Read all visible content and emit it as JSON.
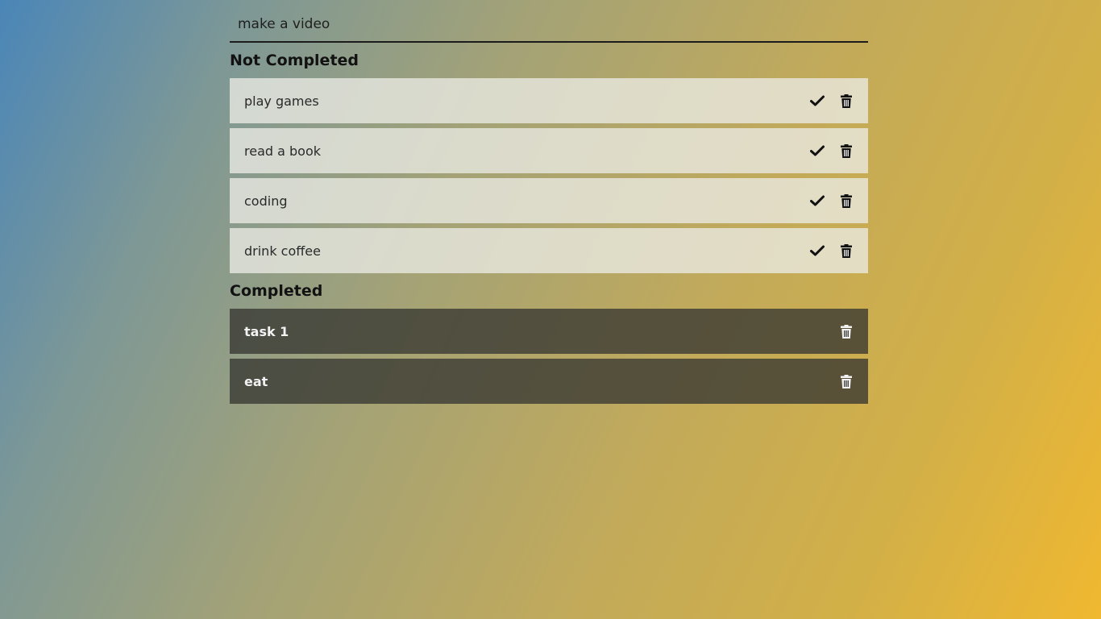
{
  "input": {
    "value": "make a video",
    "placeholder": ""
  },
  "sections": {
    "not_completed_title": "Not Completed",
    "completed_title": "Completed"
  },
  "not_completed": [
    {
      "label": "play games"
    },
    {
      "label": "read a book"
    },
    {
      "label": "coding"
    },
    {
      "label": "drink coffee"
    }
  ],
  "completed": [
    {
      "label": "task 1"
    },
    {
      "label": "eat"
    }
  ],
  "icons": {
    "complete": "check-icon",
    "delete": "trash-icon"
  },
  "colors": {
    "gradient_start": "#4a86b8",
    "gradient_end": "#f0b830",
    "pending_bg": "#ebebe4",
    "done_bg": "#373732"
  }
}
